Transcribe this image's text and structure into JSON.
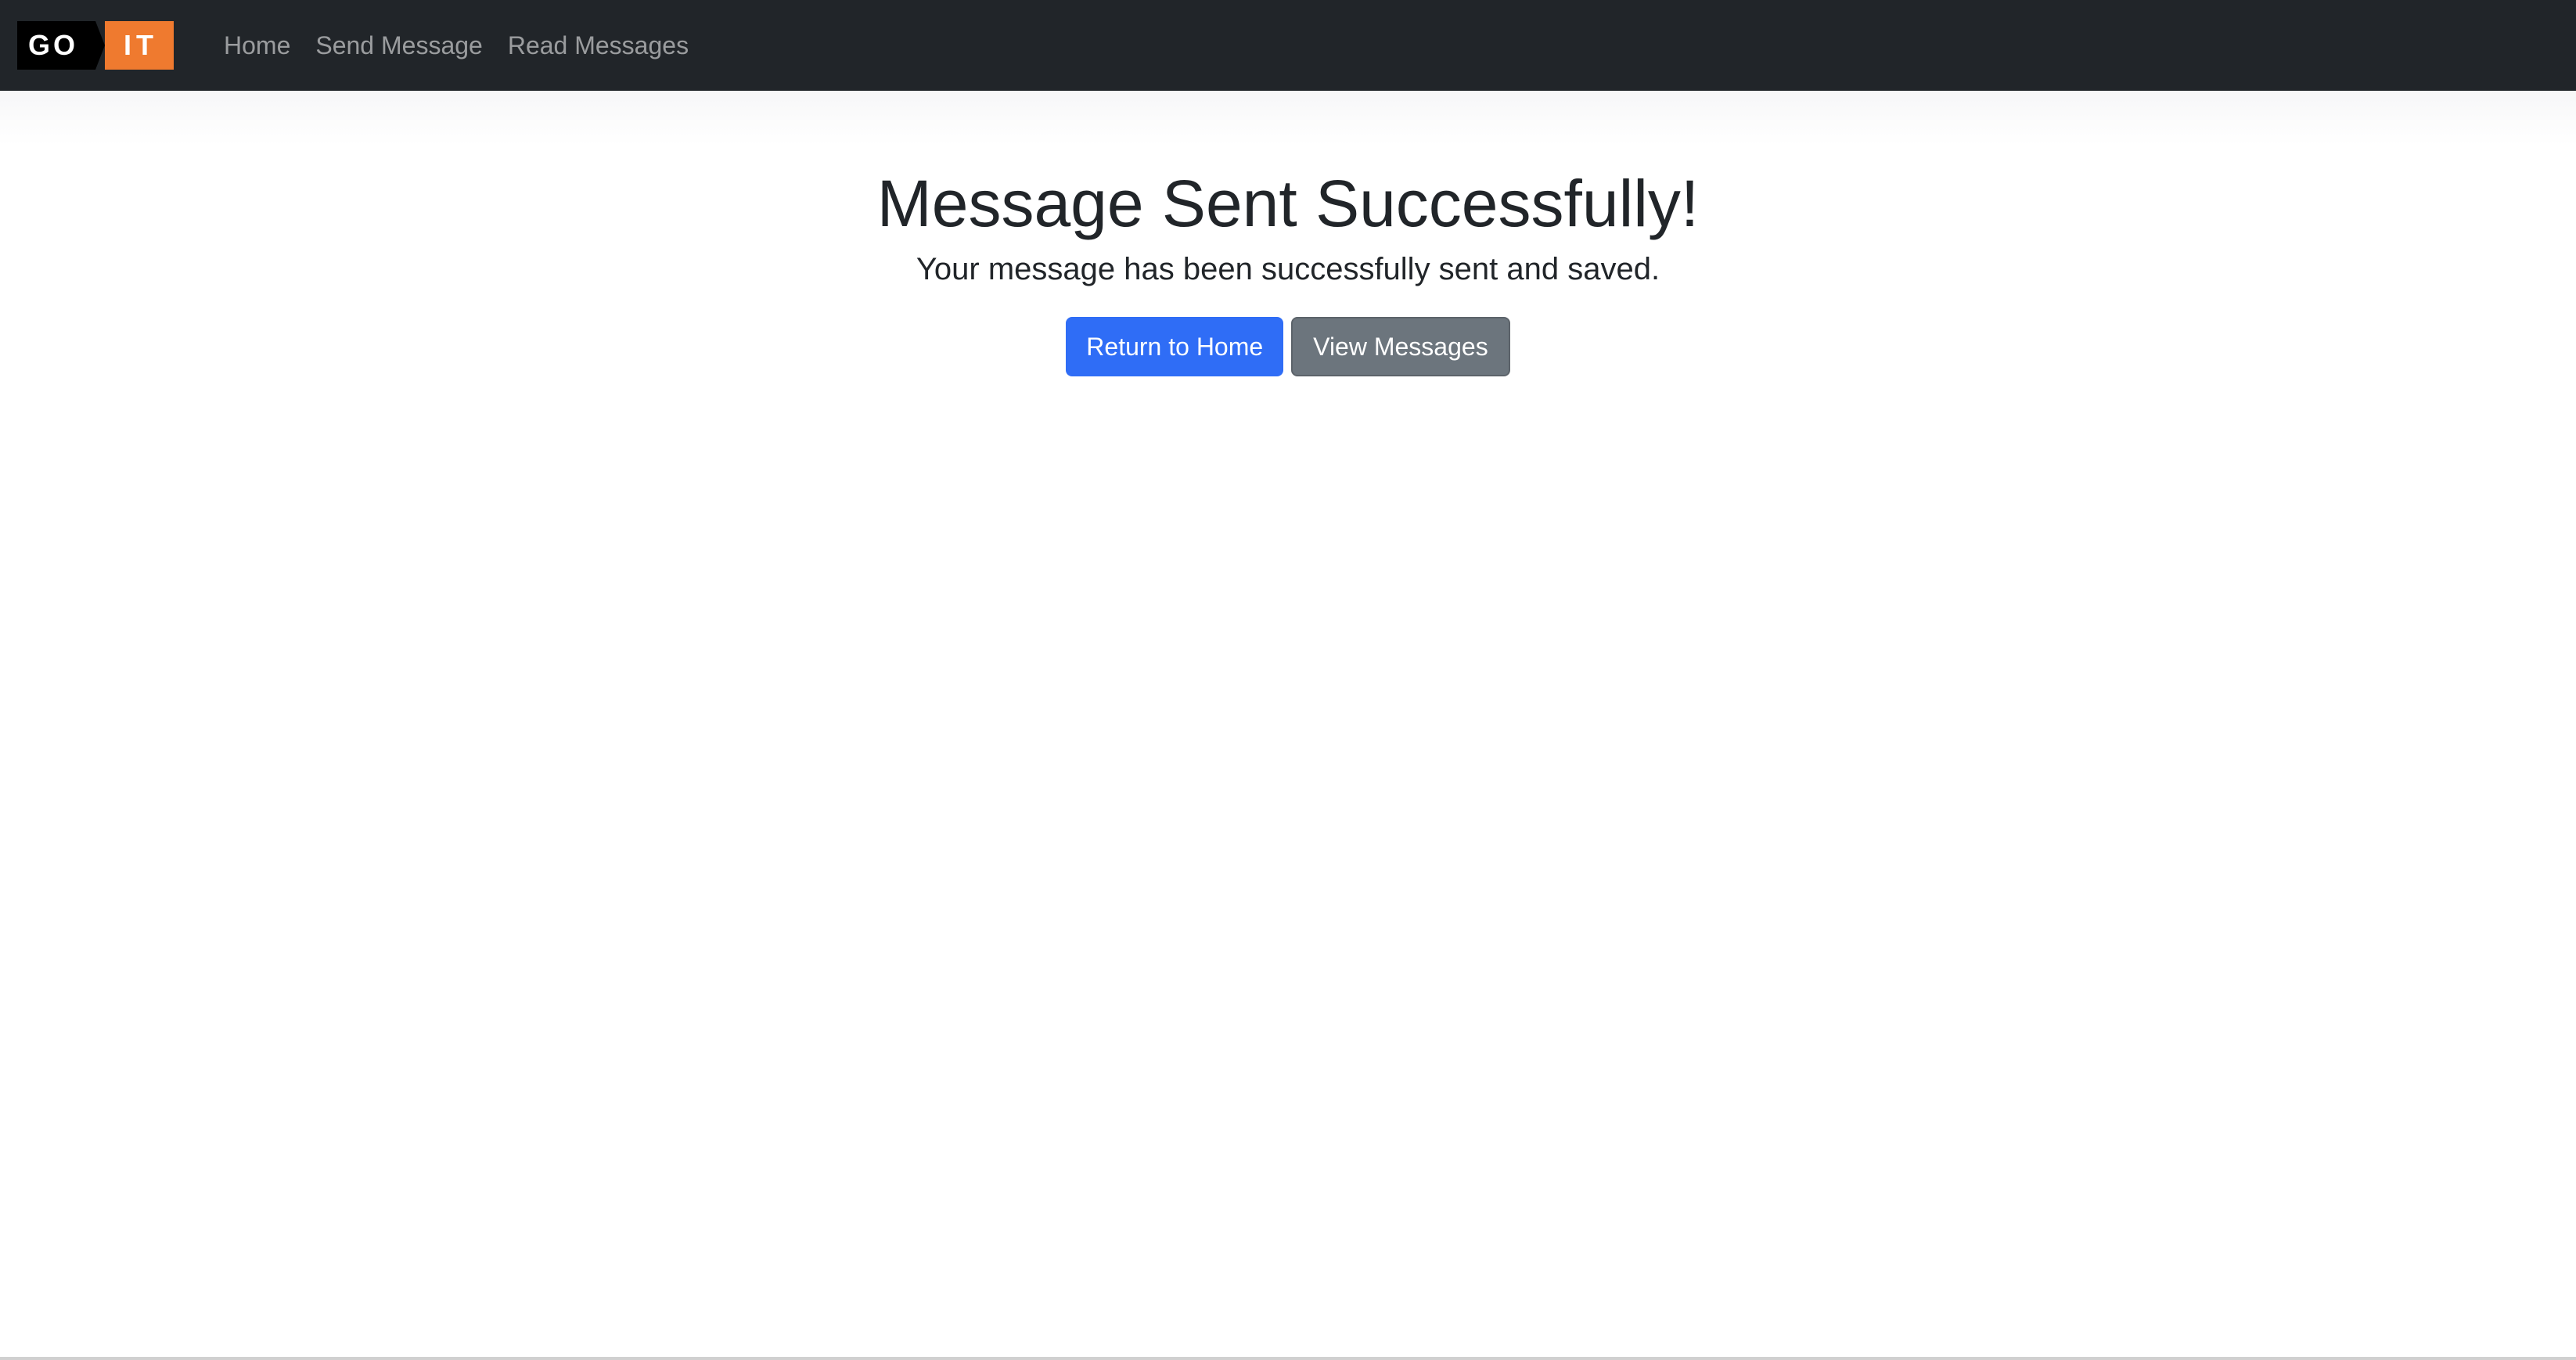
{
  "navbar": {
    "logo": {
      "left_text": "GO",
      "right_text": "IT",
      "left_color": "#000000",
      "right_color": "#EF7A2F"
    },
    "links": [
      {
        "label": "Home"
      },
      {
        "label": "Send Message"
      },
      {
        "label": "Read Messages"
      }
    ]
  },
  "main": {
    "title": "Message Sent Successfully!",
    "subtitle": "Your message has been successfully sent and saved.",
    "buttons": {
      "primary_label": "Return to Home",
      "secondary_label": "View Messages"
    }
  },
  "colors": {
    "navbar_bg": "#212529",
    "primary": "#2F6DF6",
    "secondary": "#6C757D"
  }
}
